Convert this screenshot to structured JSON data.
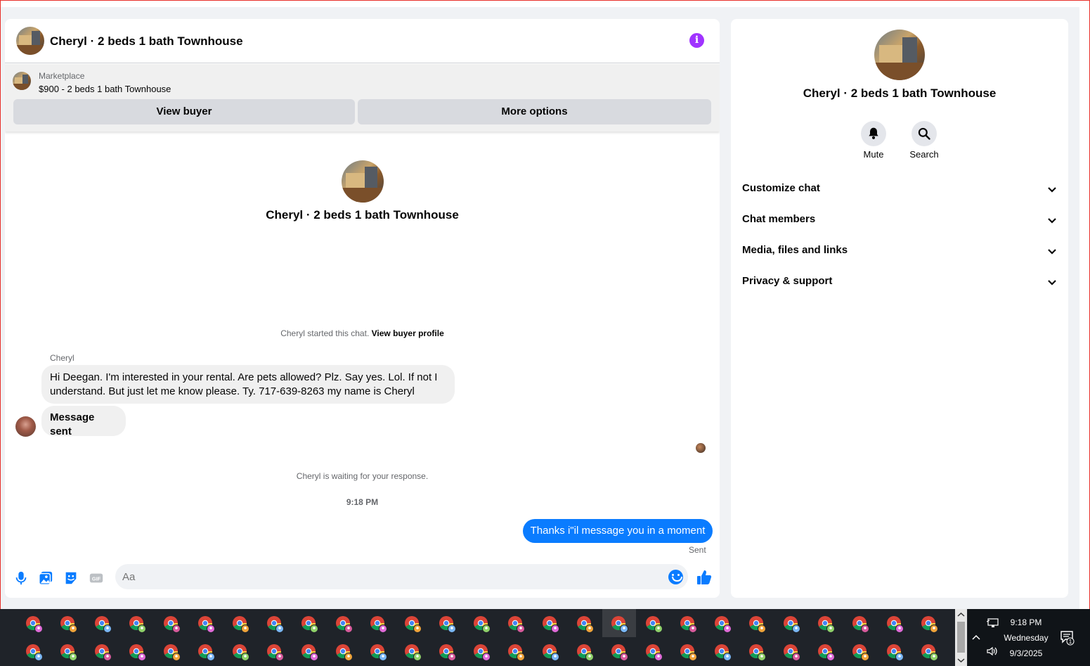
{
  "header": {
    "title": "Cheryl · 2 beds 1 bath Townhouse"
  },
  "marketplace": {
    "label": "Marketplace",
    "listing": "$900 - 2 beds 1 bath Townhouse",
    "view_buyer": "View buyer",
    "more_options": "More options"
  },
  "conversation": {
    "title": "Cheryl · 2 beds 1 bath Townhouse",
    "started_text": "Cheryl started this chat.",
    "view_profile": "View buyer profile",
    "sender": "Cheryl",
    "message_1": "Hi Deegan. I'm interested in your rental.  Are pets allowed? Plz. Say yes. Lol. If not I understand.  But just let me know please.  Ty.   717-639-8263 my name is Cheryl",
    "message_2": "Message sent",
    "waiting": "Cheryl is waiting for your response.",
    "time": "9:18 PM",
    "outgoing": "Thanks i\"il message you in a moment",
    "status": "Sent"
  },
  "composer": {
    "placeholder": "Aa",
    "gif": "GIF"
  },
  "side": {
    "title": "Cheryl · 2 beds 1 bath Townhouse",
    "mute": "Mute",
    "search": "Search",
    "sections": [
      "Customize chat",
      "Chat members",
      "Media, files and links",
      "Privacy & support"
    ]
  },
  "tray": {
    "time": "9:18 PM",
    "day": "Wednesday",
    "date": "9/3/2025",
    "notifications": "1"
  },
  "colors": {
    "accent": "#0a7cff",
    "info": "#a033ff",
    "incoming_bubble": "#f0f0f0"
  }
}
